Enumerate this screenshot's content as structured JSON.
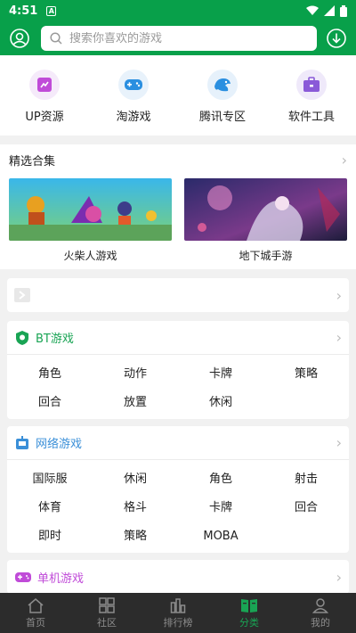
{
  "status": {
    "time": "4:51"
  },
  "search": {
    "placeholder": "搜索你喜欢的游戏"
  },
  "top_categories": [
    {
      "label": "UP资源",
      "icon": "up-resource-icon",
      "color": "#c04bd8",
      "bg": "#f5eafa"
    },
    {
      "label": "淘游戏",
      "icon": "gamepad-icon",
      "color": "#2a8fe0",
      "bg": "#e8f2fb"
    },
    {
      "label": "腾讯专区",
      "icon": "tencent-icon",
      "color": "#2a8fe0",
      "bg": "#e6f1fb"
    },
    {
      "label": "软件工具",
      "icon": "toolbox-icon",
      "color": "#8a5ad8",
      "bg": "#efe9fa"
    }
  ],
  "featured": {
    "title": "精选合集",
    "items": [
      {
        "title": "火柴人游戏"
      },
      {
        "title": "地下城手游"
      }
    ]
  },
  "sections": {
    "bt": {
      "title": "BT游戏",
      "color": "#19a454",
      "tags": [
        "角色",
        "动作",
        "卡牌",
        "策略",
        "回合",
        "放置",
        "休闲"
      ]
    },
    "online": {
      "title": "网络游戏",
      "color": "#3a8fd8",
      "tags": [
        "国际服",
        "休闲",
        "角色",
        "射击",
        "体育",
        "格斗",
        "卡牌",
        "回合",
        "即时",
        "策略",
        "MOBA"
      ]
    },
    "single": {
      "title": "单机游戏",
      "color": "#c04bd8"
    }
  },
  "tabs": [
    {
      "label": "首页",
      "icon": "home-icon"
    },
    {
      "label": "社区",
      "icon": "community-icon"
    },
    {
      "label": "排行榜",
      "icon": "ranking-icon"
    },
    {
      "label": "分类",
      "icon": "category-icon",
      "active": true
    },
    {
      "label": "我的",
      "icon": "profile-icon"
    }
  ]
}
